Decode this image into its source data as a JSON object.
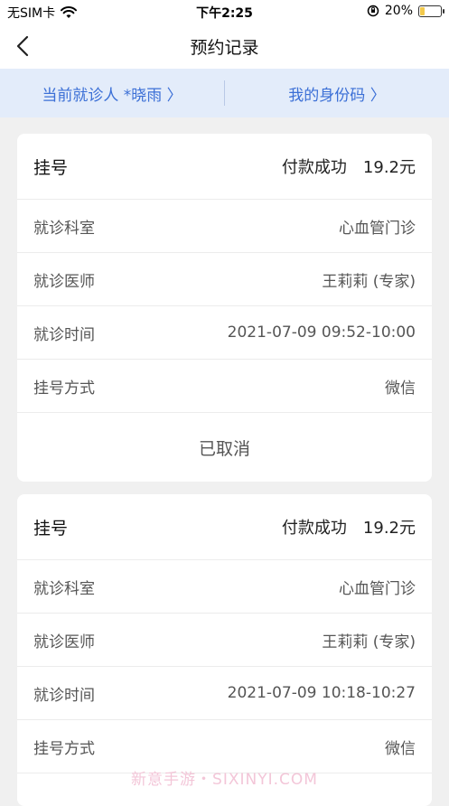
{
  "status_bar": {
    "carrier": "无SIM卡",
    "time": "下午2:25",
    "battery": "20%",
    "battery_level": 0.2
  },
  "nav": {
    "title": "预约记录"
  },
  "patient_bar": {
    "current_patient": "当前就诊人 *晓雨 〉",
    "my_id_code": "我的身份码 〉"
  },
  "records": [
    {
      "type": "挂号",
      "pay_status": "付款成功",
      "amount": "19.2元",
      "rows": [
        {
          "label": "就诊科室",
          "value": "心血管门诊"
        },
        {
          "label": "就诊医师",
          "value": "王莉莉 (专家)"
        },
        {
          "label": "就诊时间",
          "value": "2021-07-09 09:52-10:00"
        },
        {
          "label": "挂号方式",
          "value": "微信"
        }
      ],
      "footer": "已取消"
    },
    {
      "type": "挂号",
      "pay_status": "付款成功",
      "amount": "19.2元",
      "rows": [
        {
          "label": "就诊科室",
          "value": "心血管门诊"
        },
        {
          "label": "就诊医师",
          "value": "王莉莉 (专家)"
        },
        {
          "label": "就诊时间",
          "value": "2021-07-09 10:18-10:27"
        },
        {
          "label": "挂号方式",
          "value": "微信"
        }
      ]
    }
  ],
  "watermark": "新意手游・SIXINYI.COM"
}
